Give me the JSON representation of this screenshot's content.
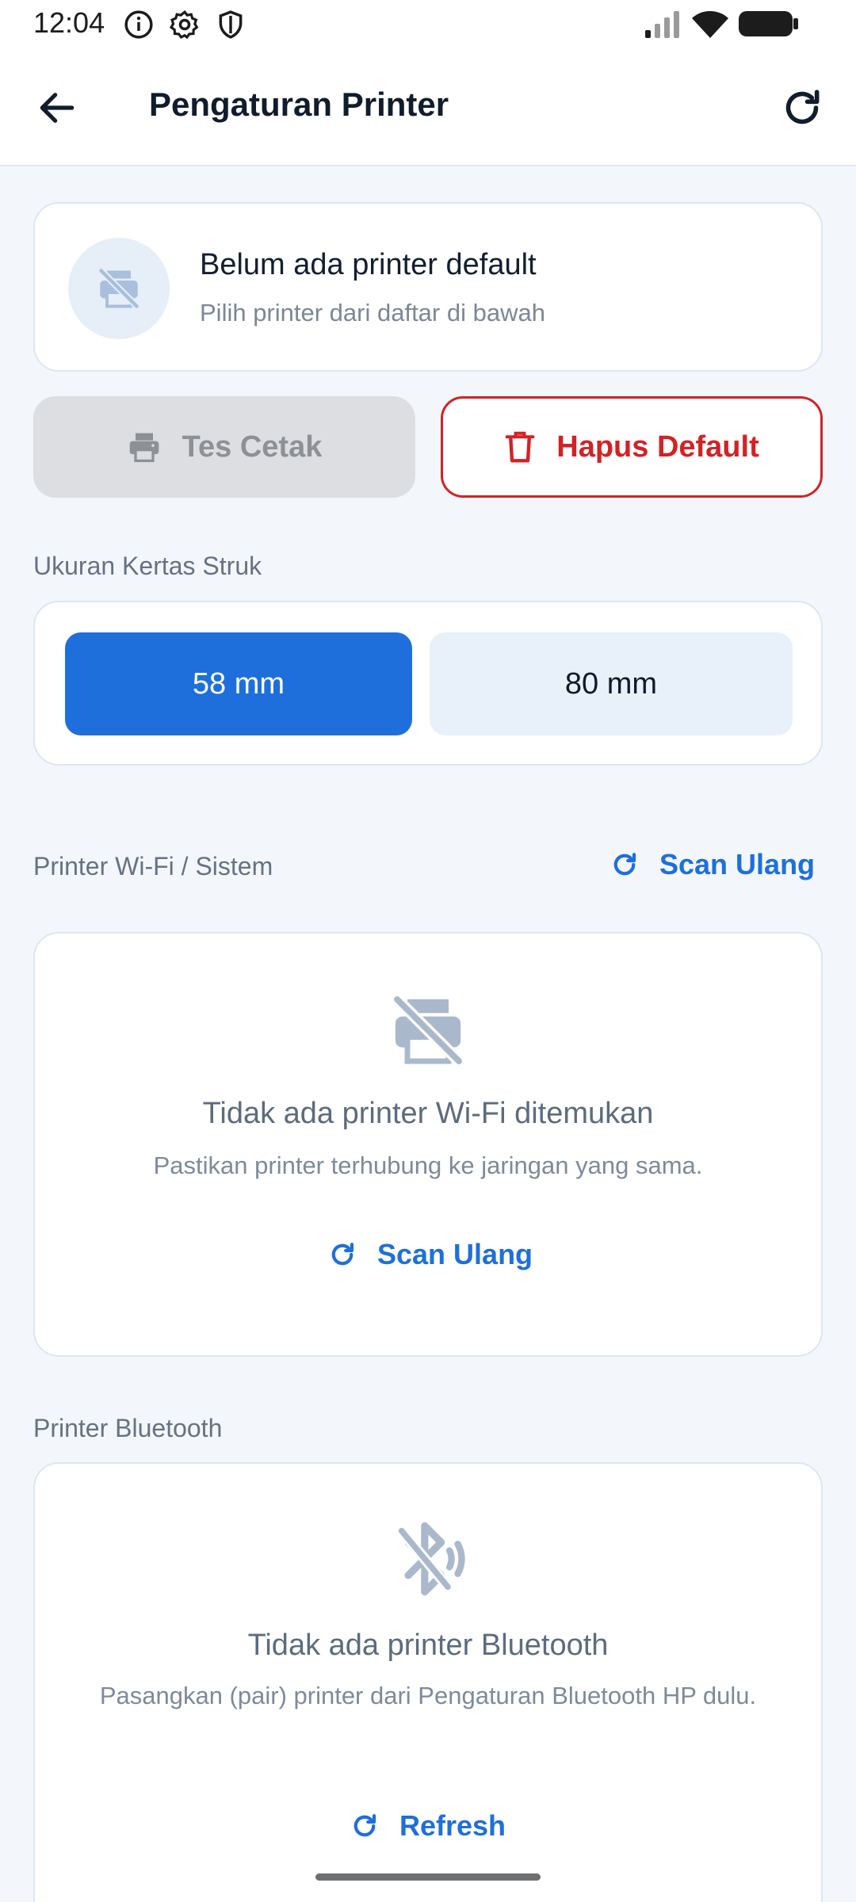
{
  "status_bar": {
    "time": "12:04",
    "left_icons": [
      "info-icon",
      "settings-gear-icon",
      "shield-icon"
    ],
    "right_icons": [
      "signal-icon",
      "wifi-icon",
      "battery-icon"
    ]
  },
  "app_bar": {
    "title": "Pengaturan Printer",
    "back_icon": "arrow-left-icon",
    "refresh_icon": "refresh-icon"
  },
  "default_printer": {
    "icon": "printer-off-icon",
    "title": "Belum ada printer default",
    "subtitle": "Pilih printer dari daftar di bawah"
  },
  "actions": {
    "test_print": {
      "label": "Tes Cetak",
      "icon": "printer-icon",
      "enabled": false
    },
    "remove_default": {
      "label": "Hapus Default",
      "icon": "trash-icon",
      "color": "#d32225"
    }
  },
  "paper_size": {
    "label": "Ukuran Kertas Struk",
    "options": [
      "58 mm",
      "80 mm"
    ],
    "selected": "58 mm",
    "accent": "#1e6fdc"
  },
  "wifi_section": {
    "label": "Printer Wi-Fi / Sistem",
    "scan_label": "Scan Ulang",
    "empty": {
      "icon": "printer-off-icon",
      "title": "Tidak ada printer Wi-Fi ditemukan",
      "subtitle": "Pastikan printer terhubung ke jaringan yang sama.",
      "action_label": "Scan Ulang"
    }
  },
  "bluetooth_section": {
    "label": "Printer Bluetooth",
    "empty": {
      "icon": "bluetooth-searching-off-icon",
      "title": "Tidak ada printer Bluetooth",
      "subtitle": "Pasangkan (pair) printer dari Pengaturan Bluetooth HP dulu.",
      "action_label": "Refresh"
    }
  }
}
